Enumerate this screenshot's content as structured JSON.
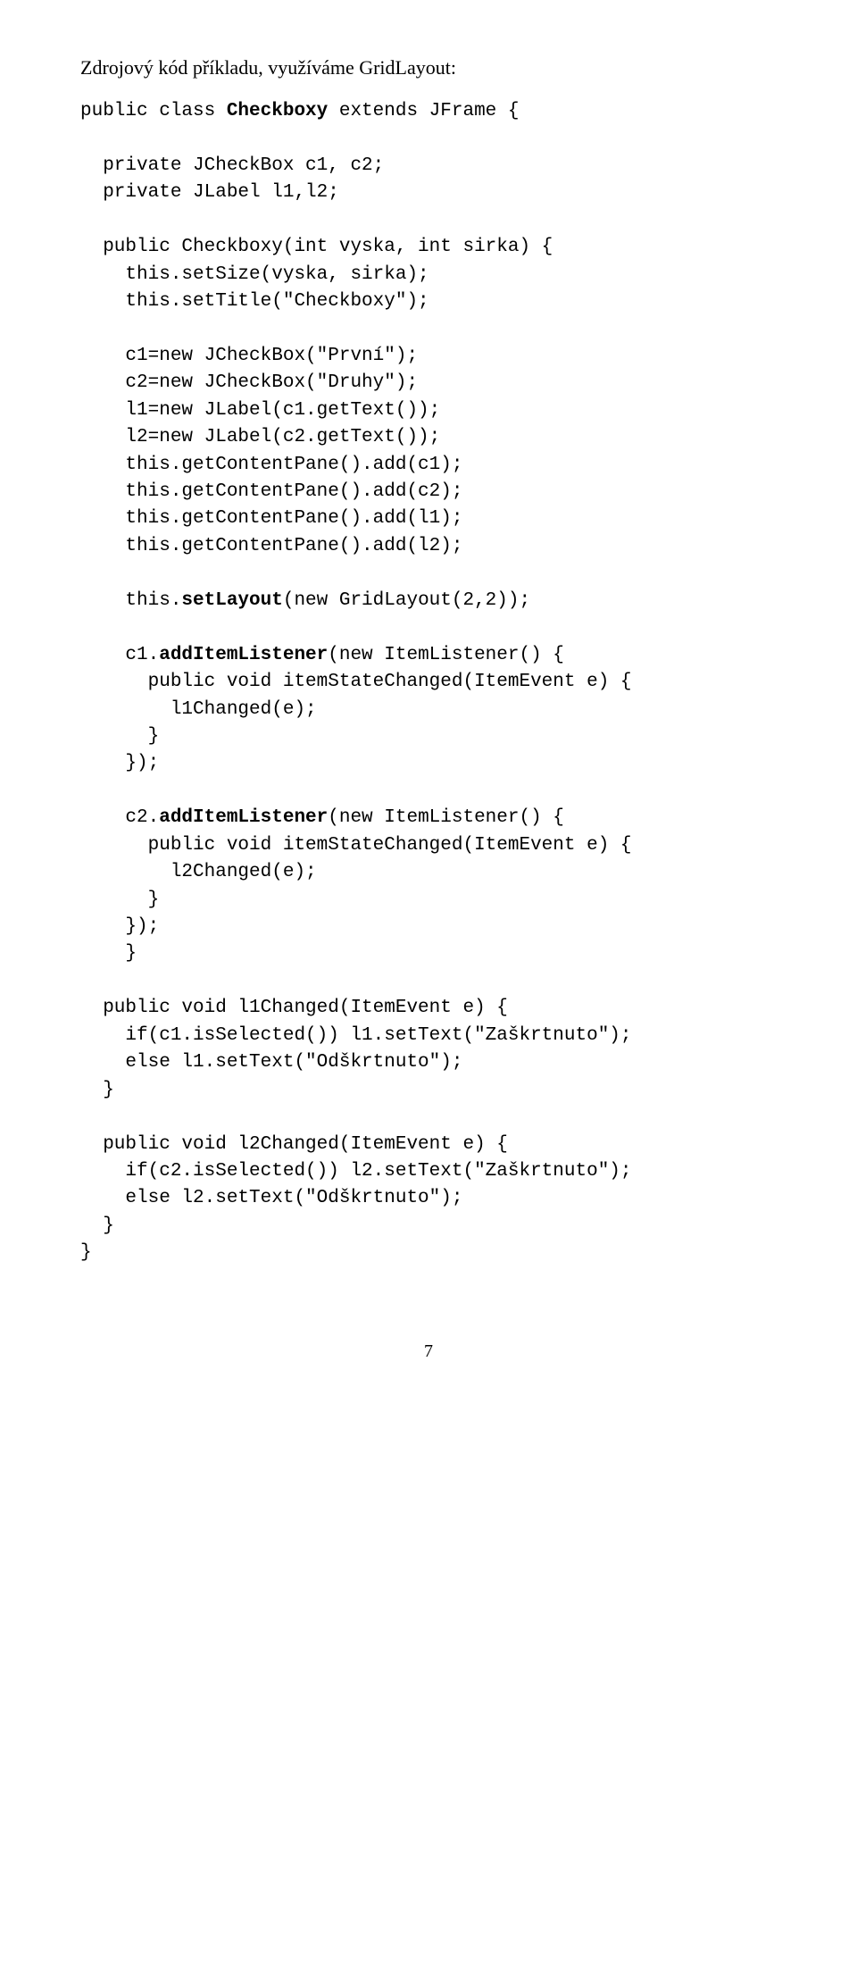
{
  "intro": "Zdrojový kód příkladu, využíváme GridLayout:",
  "code": {
    "l01a": "public class ",
    "l01b": "Checkboxy",
    "l01c": " extends JFrame {",
    "blank": "",
    "l02": "  private JCheckBox c1, c2;",
    "l03": "  private JLabel l1,l2;",
    "l04": "  public Checkboxy(int vyska, int sirka) {",
    "l05": "    this.setSize(vyska, sirka);",
    "l06": "    this.setTitle(\"Checkboxy\");",
    "l07": "    c1=new JCheckBox(\"První\");",
    "l08": "    c2=new JCheckBox(\"Druhy\");",
    "l09": "    l1=new JLabel(c1.getText());",
    "l10": "    l2=new JLabel(c2.getText());",
    "l11": "    this.getContentPane().add(c1);",
    "l12": "    this.getContentPane().add(c2);",
    "l13": "    this.getContentPane().add(l1);",
    "l14": "    this.getContentPane().add(l2);",
    "l15a": "    this.",
    "l15b": "setLayout",
    "l15c": "(new GridLayout(2,2));",
    "l16a": "    c1.",
    "l16b": "addItemListener",
    "l16c": "(new ItemListener() {",
    "l17": "      public void itemStateChanged(ItemEvent e) {",
    "l18": "        l1Changed(e);",
    "l19": "      }",
    "l20": "    });",
    "l21a": "    c2.",
    "l21b": "addItemListener",
    "l21c": "(new ItemListener() {",
    "l22": "      public void itemStateChanged(ItemEvent e) {",
    "l23": "        l2Changed(e);",
    "l24": "      }",
    "l25": "    });",
    "l26": "    }",
    "l27": "  public void l1Changed(ItemEvent e) {",
    "l28": "    if(c1.isSelected()) l1.setText(\"Zaškrtnuto\");",
    "l29": "    else l1.setText(\"Odškrtnuto\");",
    "l30": "  }",
    "l31": "  public void l2Changed(ItemEvent e) {",
    "l32": "    if(c2.isSelected()) l2.setText(\"Zaškrtnuto\");",
    "l33": "    else l2.setText(\"Odškrtnuto\");",
    "l34": "  }",
    "l35": "}"
  },
  "pageNumber": "7"
}
